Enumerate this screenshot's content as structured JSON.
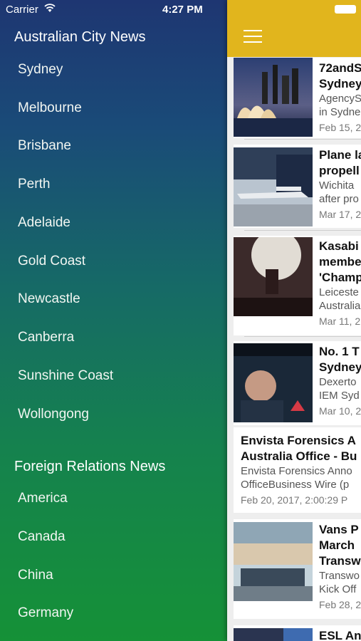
{
  "status": {
    "carrier": "Carrier",
    "time": "4:27 PM"
  },
  "drawer": {
    "section1_title": "Australian City News",
    "cities": [
      "Sydney",
      "Melbourne",
      "Brisbane",
      "Perth",
      "Adelaide",
      "Gold Coast",
      "Newcastle",
      "Canberra",
      "Sunshine Coast",
      "Wollongong"
    ],
    "section2_title": "Foreign Relations News",
    "countries": [
      "America",
      "Canada",
      "China",
      "Germany"
    ]
  },
  "content": {
    "articles": [
      {
        "title": [
          "72andS",
          "Sydney"
        ],
        "source": [
          "AgencyS",
          "in Sydne"
        ],
        "date": "Feb 15, 2"
      },
      {
        "title": [
          "Plane la",
          "propell"
        ],
        "source": [
          "Wichita",
          "after pro"
        ],
        "date": "Mar 17, 2"
      },
      {
        "title": [
          "Kasabi",
          "membe",
          "'Champ"
        ],
        "source": [
          "Leiceste",
          "Australia"
        ],
        "date": "Mar 11, 2"
      },
      {
        "title": [
          "No. 1 T",
          "Sydney"
        ],
        "source": [
          "Dexerto",
          "IEM Syd"
        ],
        "date": "Mar 10, 2"
      },
      {
        "title": [
          "Envista Forensics A",
          "Australia Office - Bu"
        ],
        "source": [
          "Envista Forensics Anno",
          "OfficeBusiness Wire (p"
        ],
        "date": "Feb 20, 2017, 2:00:29 P"
      },
      {
        "title": [
          "Vans P",
          "March",
          "Transw"
        ],
        "source": [
          "Transwo",
          "Kick Off"
        ],
        "date": "Feb 28, 2"
      },
      {
        "title": [
          "ESL An"
        ],
        "source": [],
        "date": ""
      }
    ]
  },
  "colors": {
    "topbar": "#e1b51d",
    "drawer_top": "#1e3672",
    "drawer_bottom": "#159137"
  }
}
